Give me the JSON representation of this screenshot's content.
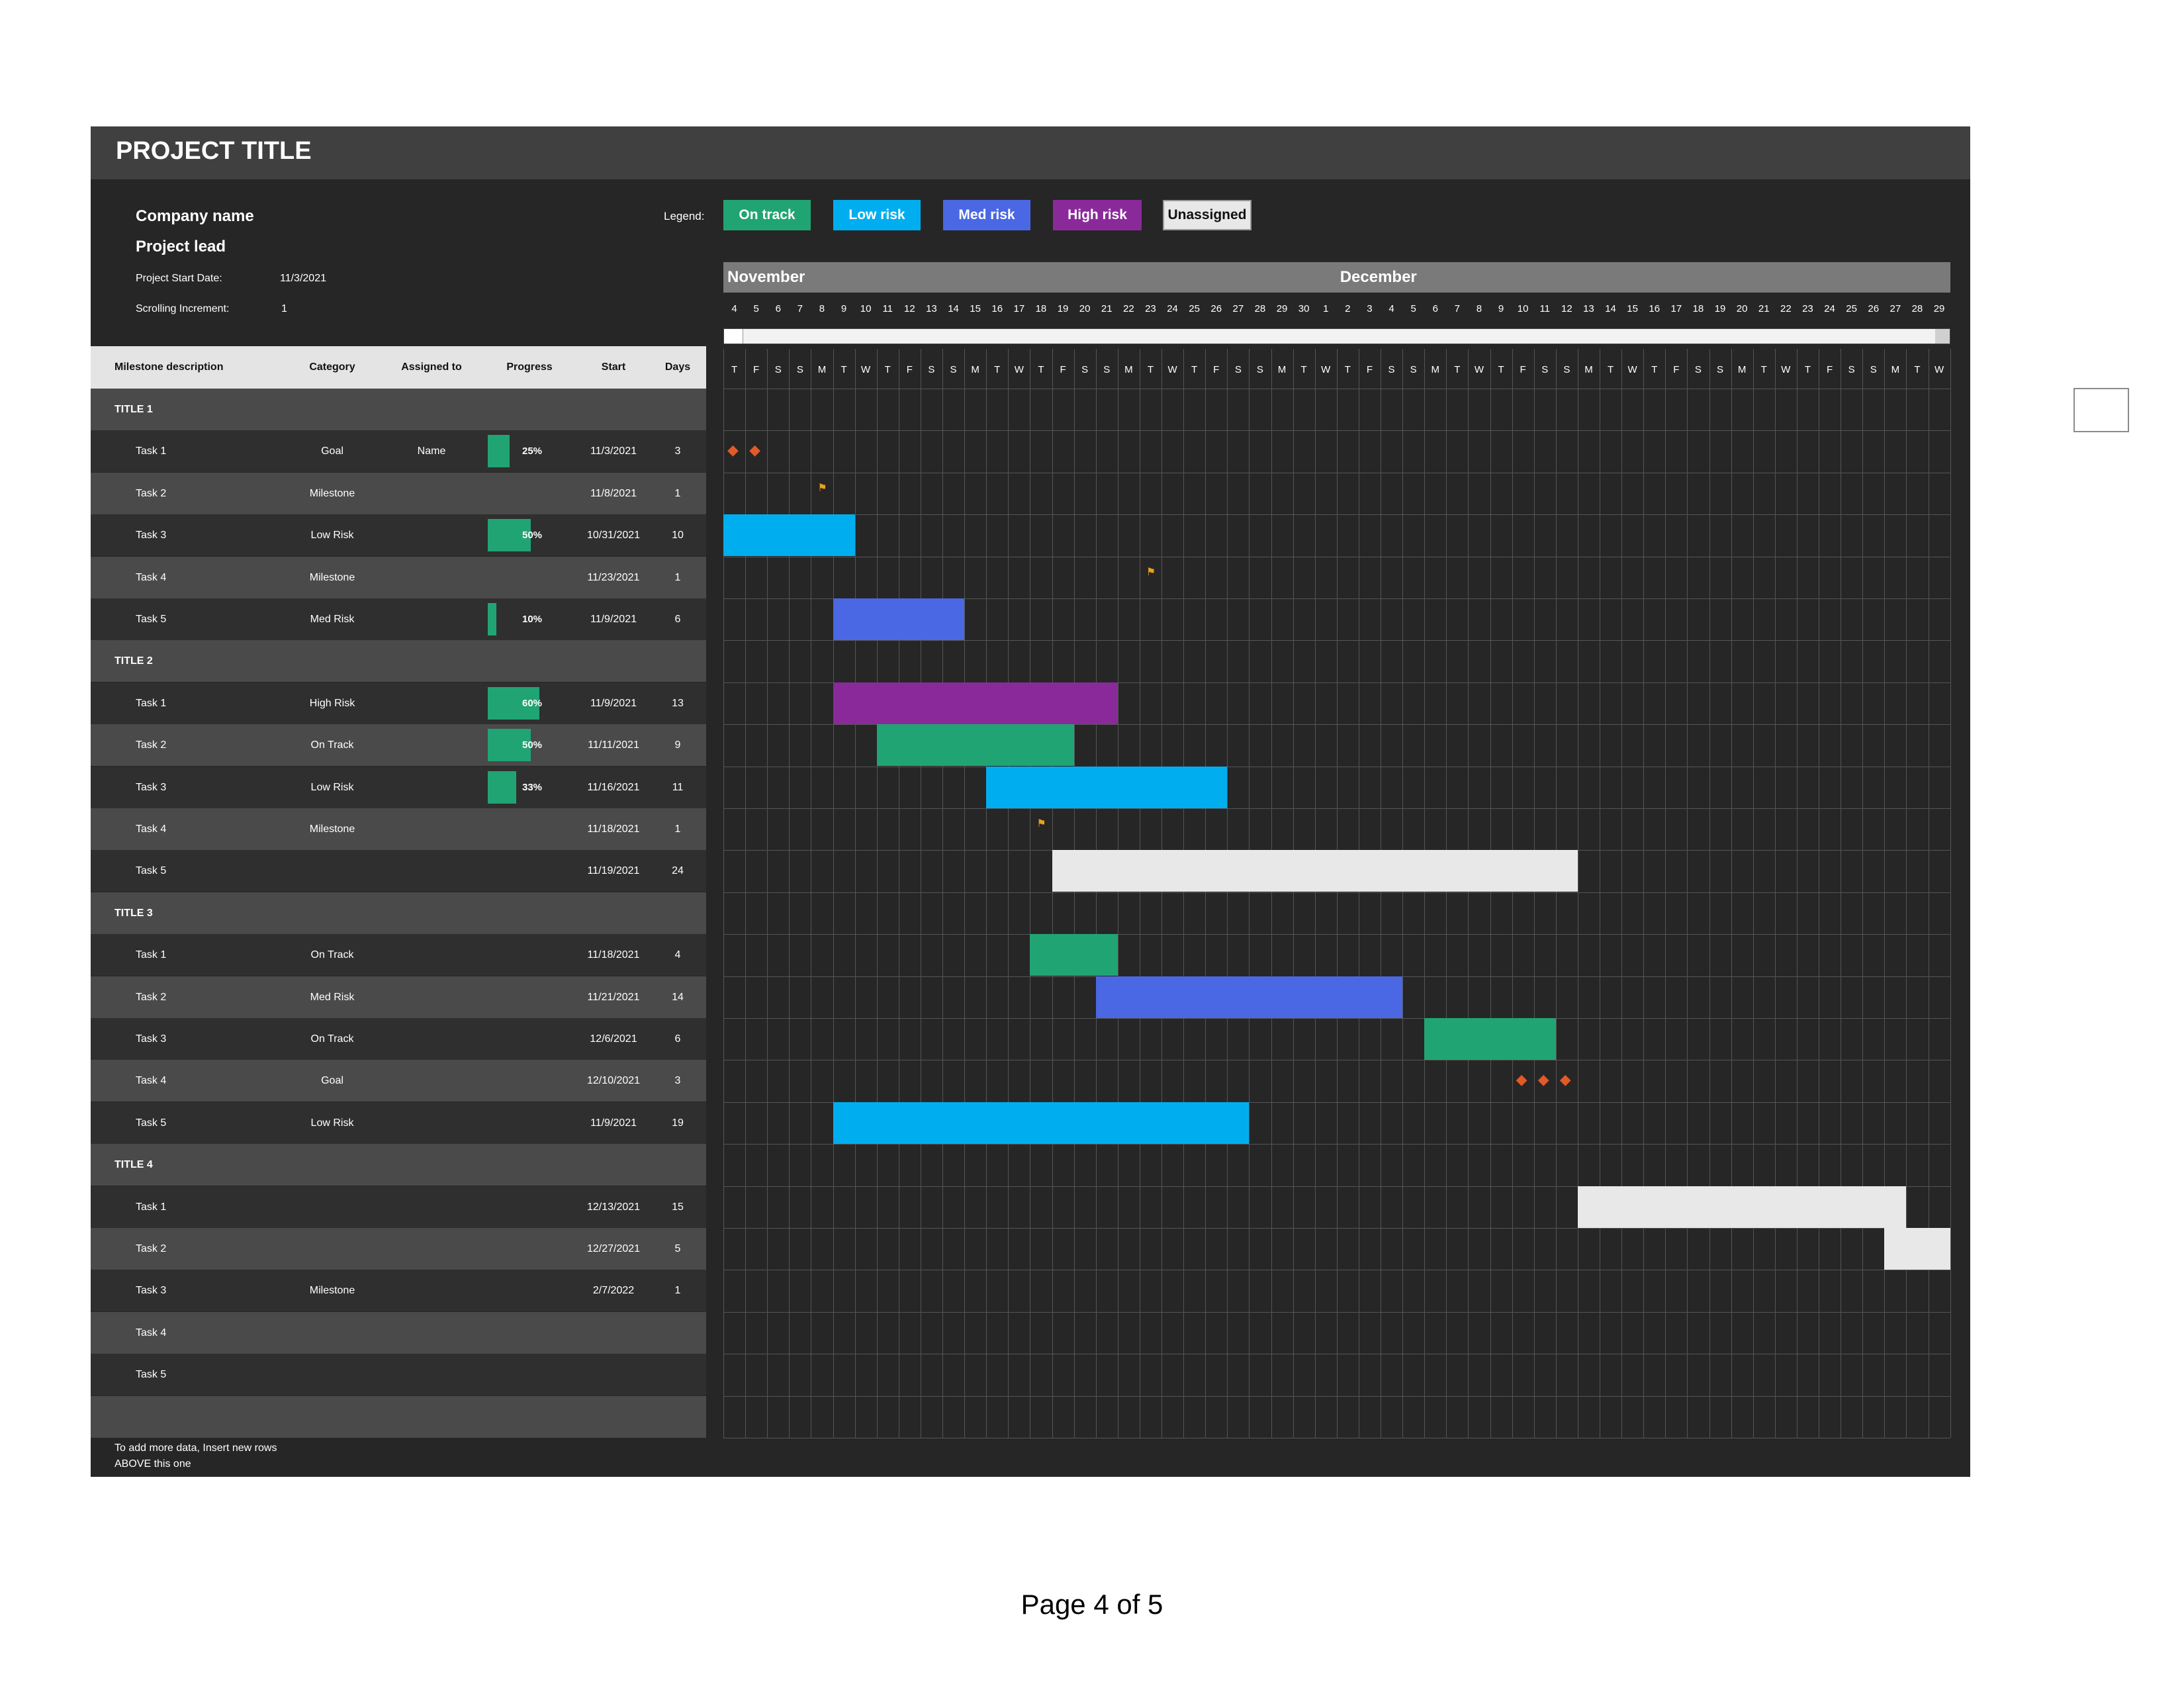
{
  "header": {
    "project_title": "PROJECT TITLE"
  },
  "info": {
    "company_name": "Company name",
    "project_lead": "Project lead",
    "start_date_label": "Project Start Date:",
    "start_date_value": "11/3/2021",
    "scroll_label": "Scrolling Increment:",
    "scroll_value": "1"
  },
  "legend": {
    "label": "Legend:",
    "items": [
      {
        "label": "On track",
        "color": "#21a474"
      },
      {
        "label": "Low risk",
        "color": "#00aeef"
      },
      {
        "label": "Med risk",
        "color": "#4a68e4"
      },
      {
        "label": "High risk",
        "color": "#8a2a9a"
      },
      {
        "label": "Unassigned",
        "color": "#e8e8e8"
      }
    ]
  },
  "columns": [
    "Milestone description",
    "Category",
    "Assigned to",
    "Progress",
    "Start",
    "Days"
  ],
  "rows": [
    {
      "type": "title",
      "name": "TITLE 1"
    },
    {
      "type": "task",
      "name": "Task 1",
      "category": "Goal",
      "assigned": "Name",
      "progress": "25%",
      "start": "11/3/2021",
      "days": "3"
    },
    {
      "type": "task",
      "name": "Task 2",
      "category": "Milestone",
      "assigned": "",
      "progress": "",
      "start": "11/8/2021",
      "days": "1"
    },
    {
      "type": "task",
      "name": "Task 3",
      "category": "Low Risk",
      "assigned": "",
      "progress": "50%",
      "start": "10/31/2021",
      "days": "10"
    },
    {
      "type": "task",
      "name": "Task 4",
      "category": "Milestone",
      "assigned": "",
      "progress": "",
      "start": "11/23/2021",
      "days": "1"
    },
    {
      "type": "task",
      "name": "Task 5",
      "category": "Med Risk",
      "assigned": "",
      "progress": "10%",
      "start": "11/9/2021",
      "days": "6"
    },
    {
      "type": "title",
      "name": "TITLE 2"
    },
    {
      "type": "task",
      "name": "Task 1",
      "category": "High Risk",
      "assigned": "",
      "progress": "60%",
      "start": "11/9/2021",
      "days": "13"
    },
    {
      "type": "task",
      "name": "Task 2",
      "category": "On Track",
      "assigned": "",
      "progress": "50%",
      "start": "11/11/2021",
      "days": "9"
    },
    {
      "type": "task",
      "name": "Task 3",
      "category": "Low Risk",
      "assigned": "",
      "progress": "33%",
      "start": "11/16/2021",
      "days": "11"
    },
    {
      "type": "task",
      "name": "Task 4",
      "category": "Milestone",
      "assigned": "",
      "progress": "",
      "start": "11/18/2021",
      "days": "1"
    },
    {
      "type": "task",
      "name": "Task 5",
      "category": "",
      "assigned": "",
      "progress": "",
      "start": "11/19/2021",
      "days": "24"
    },
    {
      "type": "title",
      "name": "TITLE 3"
    },
    {
      "type": "task",
      "name": "Task 1",
      "category": "On Track",
      "assigned": "",
      "progress": "",
      "start": "11/18/2021",
      "days": "4"
    },
    {
      "type": "task",
      "name": "Task 2",
      "category": "Med Risk",
      "assigned": "",
      "progress": "",
      "start": "11/21/2021",
      "days": "14"
    },
    {
      "type": "task",
      "name": "Task 3",
      "category": "On Track",
      "assigned": "",
      "progress": "",
      "start": "12/6/2021",
      "days": "6"
    },
    {
      "type": "task",
      "name": "Task 4",
      "category": "Goal",
      "assigned": "",
      "progress": "",
      "start": "12/10/2021",
      "days": "3"
    },
    {
      "type": "task",
      "name": "Task 5",
      "category": "Low Risk",
      "assigned": "",
      "progress": "",
      "start": "11/9/2021",
      "days": "19"
    },
    {
      "type": "title",
      "name": "TITLE 4"
    },
    {
      "type": "task",
      "name": "Task 1",
      "category": "",
      "assigned": "",
      "progress": "",
      "start": "12/13/2021",
      "days": "15"
    },
    {
      "type": "task",
      "name": "Task 2",
      "category": "",
      "assigned": "",
      "progress": "",
      "start": "12/27/2021",
      "days": "5"
    },
    {
      "type": "task",
      "name": "Task 3",
      "category": "Milestone",
      "assigned": "",
      "progress": "",
      "start": "2/7/2022",
      "days": "1"
    },
    {
      "type": "task",
      "name": "Task 4",
      "category": "",
      "assigned": "",
      "progress": "",
      "start": "",
      "days": ""
    },
    {
      "type": "task",
      "name": "Task 5",
      "category": "",
      "assigned": "",
      "progress": "",
      "start": "",
      "days": ""
    },
    {
      "type": "blank",
      "name": ""
    }
  ],
  "footnote": "To add more data, Insert new rows ABOVE this one",
  "timeline": {
    "months": [
      {
        "name": "November",
        "days": 27
      },
      {
        "name": "December",
        "days": 29
      }
    ],
    "day_numbers": [
      "4",
      "5",
      "6",
      "7",
      "8",
      "9",
      "10",
      "11",
      "12",
      "13",
      "14",
      "15",
      "16",
      "17",
      "18",
      "19",
      "20",
      "21",
      "22",
      "23",
      "24",
      "25",
      "26",
      "27",
      "28",
      "29",
      "30",
      "1",
      "2",
      "3",
      "4",
      "5",
      "6",
      "7",
      "8",
      "9",
      "10",
      "11",
      "12",
      "13",
      "14",
      "15",
      "16",
      "17",
      "18",
      "19",
      "20",
      "21",
      "22",
      "23",
      "24",
      "25",
      "26",
      "27",
      "28",
      "29"
    ],
    "weekdays": [
      "T",
      "F",
      "S",
      "S",
      "M",
      "T",
      "W",
      "T",
      "F",
      "S",
      "S",
      "M",
      "T",
      "W",
      "T",
      "F",
      "S",
      "S",
      "M",
      "T",
      "W",
      "T",
      "F",
      "S",
      "S",
      "M",
      "T",
      "W",
      "T",
      "F",
      "S",
      "S",
      "M",
      "T",
      "W",
      "T",
      "F",
      "S",
      "S",
      "M",
      "T",
      "W",
      "T",
      "F",
      "S",
      "S",
      "M",
      "T",
      "W",
      "T",
      "F",
      "S",
      "S",
      "M",
      "T",
      "W"
    ]
  },
  "gantt_items": [
    {
      "row": 1,
      "kind": "goal",
      "days": [
        0,
        1
      ]
    },
    {
      "row": 2,
      "kind": "milestone",
      "day": 4
    },
    {
      "row": 3,
      "kind": "bar",
      "start": 0,
      "span": 6,
      "color": "#00aeef"
    },
    {
      "row": 4,
      "kind": "milestone",
      "day": 19
    },
    {
      "row": 5,
      "kind": "bar",
      "start": 5,
      "span": 6,
      "color": "#4a68e4"
    },
    {
      "row": 7,
      "kind": "bar",
      "start": 5,
      "span": 13,
      "color": "#8a2a9a"
    },
    {
      "row": 8,
      "kind": "bar",
      "start": 7,
      "span": 9,
      "color": "#21a474"
    },
    {
      "row": 9,
      "kind": "bar",
      "start": 12,
      "span": 11,
      "color": "#00aeef"
    },
    {
      "row": 10,
      "kind": "milestone",
      "day": 14
    },
    {
      "row": 11,
      "kind": "bar",
      "start": 15,
      "span": 24,
      "color": "#e8e8e8"
    },
    {
      "row": 13,
      "kind": "bar",
      "start": 14,
      "span": 4,
      "color": "#21a474"
    },
    {
      "row": 14,
      "kind": "bar",
      "start": 17,
      "span": 14,
      "color": "#4a68e4"
    },
    {
      "row": 15,
      "kind": "bar",
      "start": 32,
      "span": 6,
      "color": "#21a474"
    },
    {
      "row": 16,
      "kind": "goal",
      "days": [
        36,
        37,
        38
      ]
    },
    {
      "row": 17,
      "kind": "bar",
      "start": 5,
      "span": 19,
      "color": "#00aeef"
    },
    {
      "row": 19,
      "kind": "bar",
      "start": 39,
      "span": 15,
      "color": "#e8e8e8"
    },
    {
      "row": 20,
      "kind": "bar",
      "start": 53,
      "span": 3,
      "color": "#e8e8e8"
    }
  ],
  "page_footer": "Page 4 of 5"
}
